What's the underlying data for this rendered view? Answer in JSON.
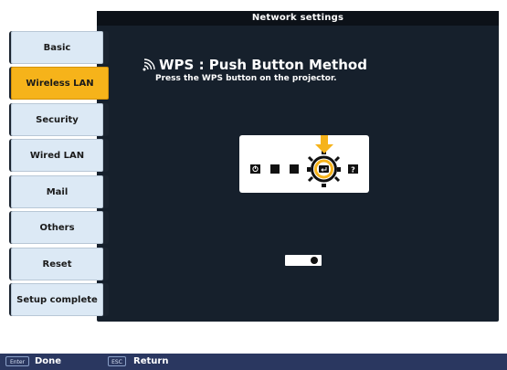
{
  "window": {
    "title": "Network settings"
  },
  "sidebar": {
    "items": [
      {
        "label": "Basic",
        "active": false
      },
      {
        "label": "Wireless LAN",
        "active": true
      },
      {
        "label": "Security",
        "active": false
      },
      {
        "label": "Wired LAN",
        "active": false
      },
      {
        "label": "Mail",
        "active": false
      },
      {
        "label": "Others",
        "active": false
      },
      {
        "label": "Reset",
        "active": false
      },
      {
        "label": "Setup complete",
        "active": false
      }
    ]
  },
  "content": {
    "title": "WPS : Push Button Method",
    "description": "Press the WPS button on the projector."
  },
  "footer": {
    "enter_key": "Enter",
    "enter_label": "Done",
    "esc_key": "ESC",
    "esc_label": "Return"
  },
  "colors": {
    "accent": "#f6b31a",
    "panel": "#16202c",
    "footer": "#2a3760"
  }
}
